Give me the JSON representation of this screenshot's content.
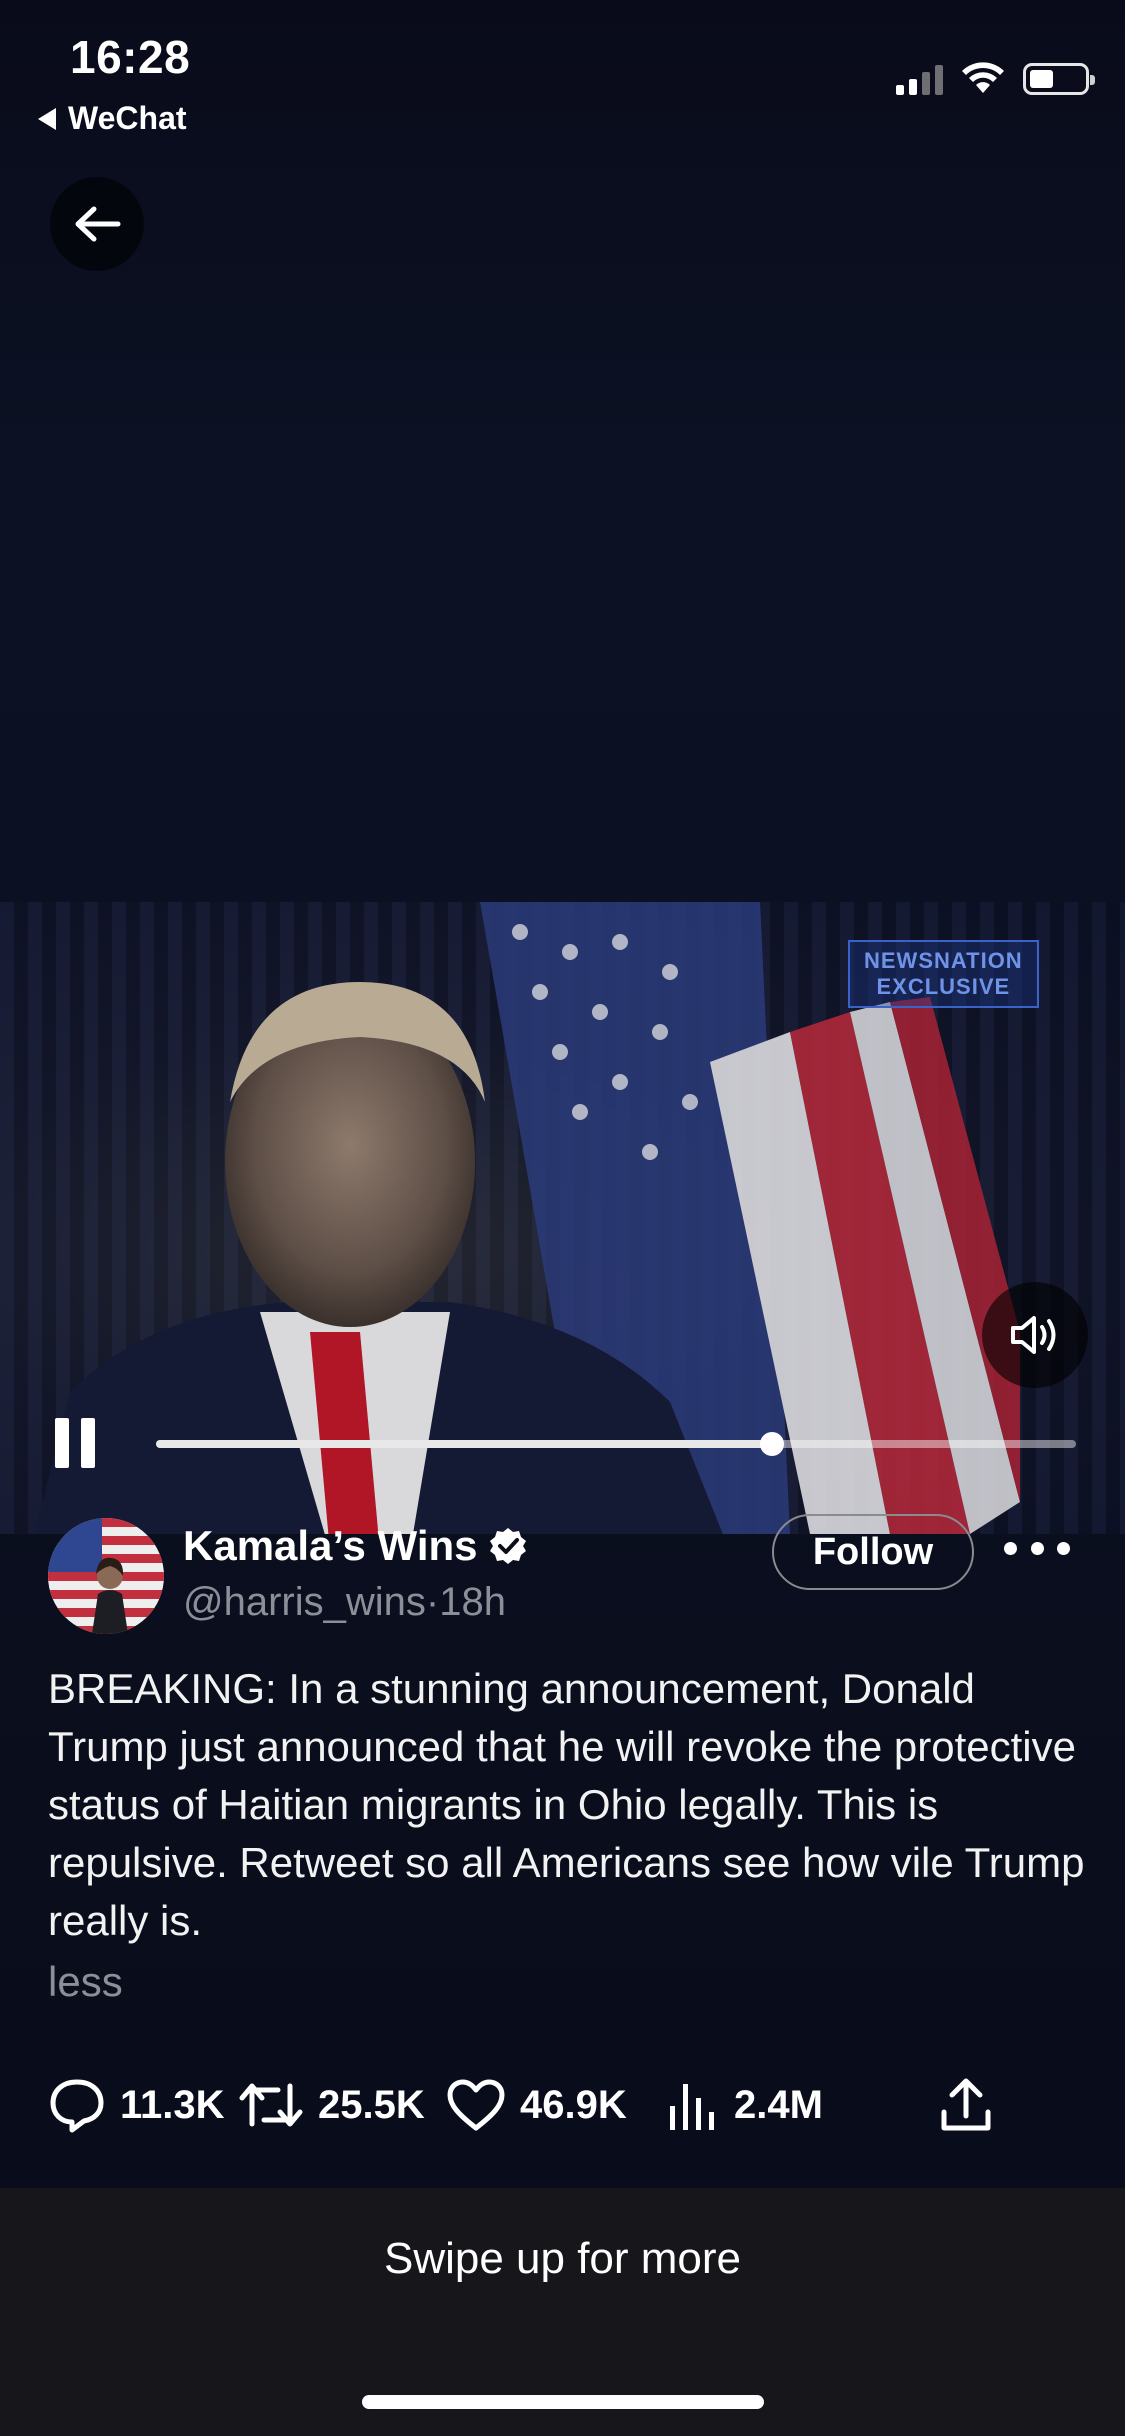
{
  "status_bar": {
    "time": "16:28",
    "back_app": "WeChat",
    "signal_icon": "cellular-signal-icon",
    "wifi_icon": "wifi-icon",
    "battery_icon": "battery-icon",
    "battery_level": 0.45
  },
  "nav": {
    "back_icon": "arrow-left-icon"
  },
  "video": {
    "watermark_line1": "NEWSNATION",
    "watermark_line2": "EXCLUSIVE",
    "progress": 0.67,
    "sound_icon": "speaker-on-icon",
    "pause_icon": "pause-icon"
  },
  "author": {
    "name": "Kamala’s Wins",
    "verified_icon": "verified-badge-icon",
    "handle": "@harris_wins",
    "separator": "·",
    "age": "18h",
    "follow_label": "Follow",
    "more_icon": "more-options-icon"
  },
  "tweet": {
    "text": "BREAKING: In a stunning announcement, Donald Trump just announced that he will revoke the protective status of Haitian migrants in Ohio legally. This is repulsive. Retweet so all Americans see how vile Trump really is.",
    "less_label": "less"
  },
  "actions": {
    "replies": "11.3K",
    "retweets": "25.5K",
    "likes": "46.9K",
    "views": "2.4M"
  },
  "footer": {
    "swipe_label": "Swipe up for more"
  },
  "colors": {
    "background": "#08091a",
    "muted_text": "#8b8f98",
    "flag_red": "#b8293a",
    "tie_red": "#c0162a"
  }
}
